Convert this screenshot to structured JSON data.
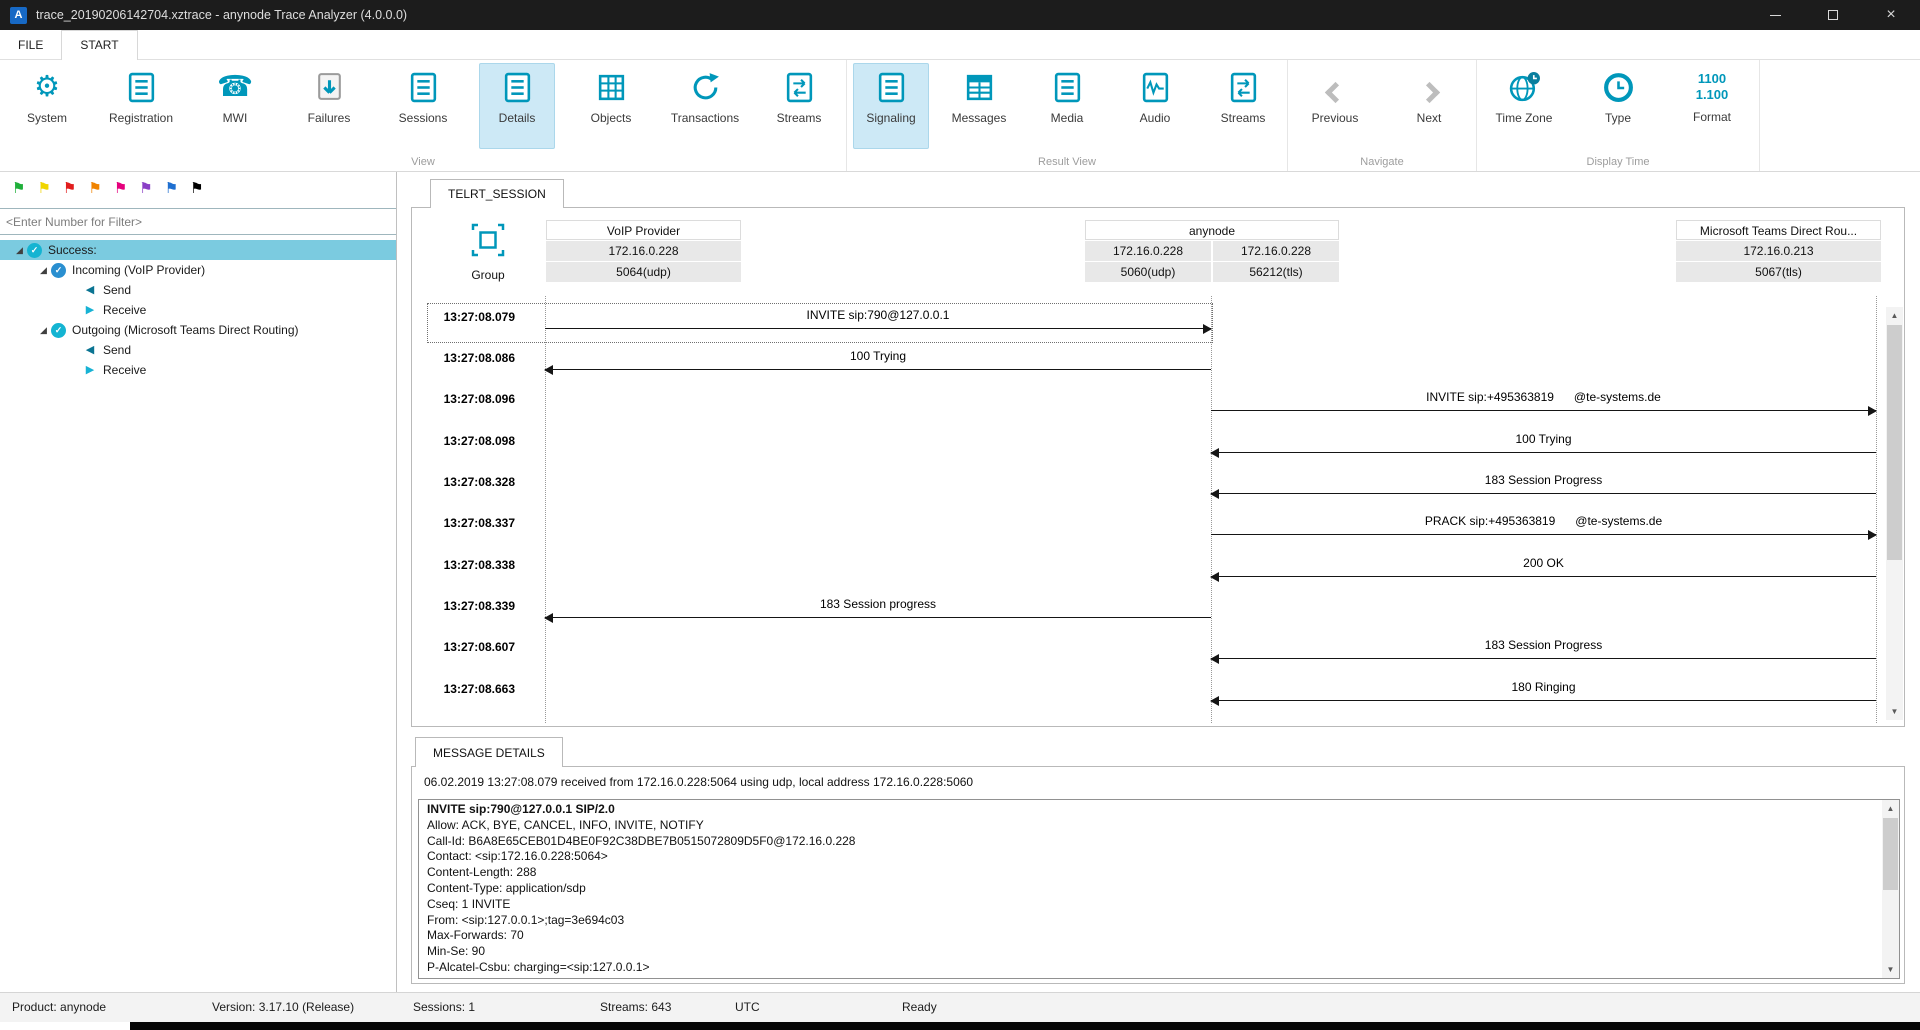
{
  "colors": {
    "accent_teal": "#0097ba",
    "ribbon_selected_bg": "#cde9f6",
    "tree_selected_bg": "#7bcbe0",
    "titlebar_bg": "#1c1c1c",
    "participant_cell_bg": "#e8e8e8"
  },
  "icons": {
    "gear": "⚙",
    "phone": "☎",
    "flag": "⚑",
    "check": "✓",
    "expander_expanded": "◢",
    "send_arrow": "◀",
    "receive_arrow": "▶",
    "scroll_up": "▲",
    "scroll_down": "▼",
    "close": "×",
    "app_logo": "A"
  },
  "titlebar": {
    "title": "trace_20190206142704.xztrace - anynode Trace Analyzer (4.0.0.0)"
  },
  "menu": {
    "file": "FILE",
    "start": "START"
  },
  "ribbon": {
    "view": {
      "label": "View",
      "system": "System",
      "registration": "Registration",
      "mwi": "MWI",
      "failures": "Failures",
      "sessions": "Sessions",
      "details": "Details",
      "objects": "Objects",
      "transactions": "Transactions",
      "streams": "Streams"
    },
    "result": {
      "label": "Result View",
      "signaling": "Signaling",
      "messages": "Messages",
      "media": "Media",
      "audio": "Audio",
      "streams": "Streams"
    },
    "navigate": {
      "label": "Navigate",
      "previous": "Previous",
      "next": "Next"
    },
    "display": {
      "label": "Display Time",
      "time_zone": "Time Zone",
      "type": "Type",
      "format": "Format",
      "format_icon_line1": "1100",
      "format_icon_line2": "1.100"
    }
  },
  "sidebar": {
    "filter_placeholder": "<Enter Number for Filter>",
    "flag_colors": [
      "#1faf3a",
      "#f0d500",
      "#e11d1d",
      "#f08300",
      "#e5007d",
      "#8a3fc6",
      "#1f6fd0",
      "#000000"
    ],
    "tree": {
      "success": "Success:",
      "incoming": "Incoming (VoIP Provider)",
      "incoming_send": "Send",
      "incoming_receive": "Receive",
      "outgoing": "Outgoing (Microsoft Teams Direct Routing)",
      "outgoing_send": "Send",
      "outgoing_receive": "Receive"
    }
  },
  "session": {
    "tab_label": "TELRT_SESSION",
    "group_label": "Group",
    "participants": {
      "voip": {
        "name": "VoIP Provider",
        "address": "172.16.0.228",
        "port": "5064(udp)"
      },
      "anynode": {
        "name": "anynode",
        "address_left": "172.16.0.228",
        "port_left": "5060(udp)",
        "address_right": "172.16.0.228",
        "port_right": "56212(tls)"
      },
      "teams": {
        "name": "Microsoft Teams Direct Rou...",
        "address": "172.16.0.213",
        "port": "5067(tls)"
      }
    },
    "messages": [
      {
        "time": "13:27:08.079",
        "label": "INVITE sip:790@127.0.0.1",
        "direction": "right",
        "span": "voip-anynode",
        "selected": true
      },
      {
        "time": "13:27:08.086",
        "label": "100 Trying",
        "direction": "left",
        "span": "voip-anynode"
      },
      {
        "time": "13:27:08.096",
        "label": "INVITE sip:+495363819      @te-systems.de",
        "direction": "right",
        "span": "anynode-teams"
      },
      {
        "time": "13:27:08.098",
        "label": "100 Trying",
        "direction": "left",
        "span": "anynode-teams"
      },
      {
        "time": "13:27:08.328",
        "label": "183 Session Progress",
        "direction": "left",
        "span": "anynode-teams"
      },
      {
        "time": "13:27:08.337",
        "label": "PRACK sip:+495363819      @te-systems.de",
        "direction": "right",
        "span": "anynode-teams"
      },
      {
        "time": "13:27:08.338",
        "label": "200 OK",
        "direction": "left",
        "span": "anynode-teams"
      },
      {
        "time": "13:27:08.339",
        "label": "183 Session progress",
        "direction": "left",
        "span": "voip-anynode"
      },
      {
        "time": "13:27:08.607",
        "label": "183 Session Progress",
        "direction": "left",
        "span": "anynode-teams"
      },
      {
        "time": "13:27:08.663",
        "label": "180 Ringing",
        "direction": "left",
        "span": "anynode-teams"
      }
    ]
  },
  "details": {
    "tab_label": "MESSAGE DETAILS",
    "summary": "06.02.2019 13:27:08.079 received from 172.16.0.228:5064 using udp, local address 172.16.0.228:5060",
    "headline": "INVITE sip:790@127.0.0.1 SIP/2.0",
    "lines": [
      "Allow: ACK, BYE, CANCEL, INFO, INVITE, NOTIFY",
      "Call-Id: B6A8E65CEB01D4BE0F92C38DBE7B0515072809D5F0@172.16.0.228",
      "Contact: <sip:172.16.0.228:5064>",
      "Content-Length: 288",
      "Content-Type: application/sdp",
      "Cseq: 1 INVITE",
      "From: <sip:127.0.0.1>;tag=3e694c03",
      "Max-Forwards: 70",
      "Min-Se: 90",
      "P-Alcatel-Csbu: charging=<sip:127.0.0.1>"
    ]
  },
  "statusbar": {
    "product": "Product: anynode",
    "version": "Version: 3.17.10 (Release)",
    "sessions": "Sessions: 1",
    "streams": "Streams: 643",
    "timezone": "UTC",
    "state": "Ready"
  }
}
